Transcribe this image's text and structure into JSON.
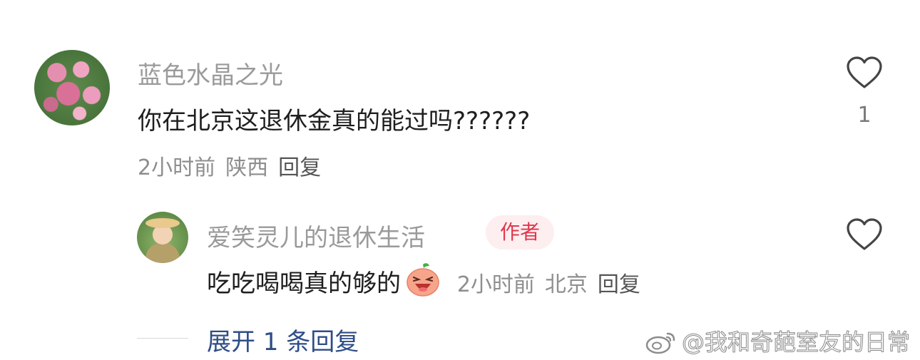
{
  "comment": {
    "username": "蓝色水晶之光",
    "text": "你在北京这退休金真的能过吗??????",
    "time": "2小时前",
    "location": "陕西",
    "reply_label": "回复",
    "like_count": "1",
    "avatar_icon": "flower-avatar"
  },
  "reply": {
    "username": "爱笑灵儿的退休生活",
    "badge": "作者",
    "text": "吃吃喝喝真的够的",
    "emoji": "laughing-peach-emoji",
    "time": "2小时前",
    "location": "北京",
    "reply_label": "回复",
    "avatar_icon": "person-avatar"
  },
  "expand_label": "展开 1 条回复",
  "watermark": "@我和奇葩室友的日常",
  "colors": {
    "username": "#9a9a9a",
    "badge_text": "#e0374e",
    "badge_bg": "#fdeef0",
    "expand_link": "#2e4d86"
  }
}
